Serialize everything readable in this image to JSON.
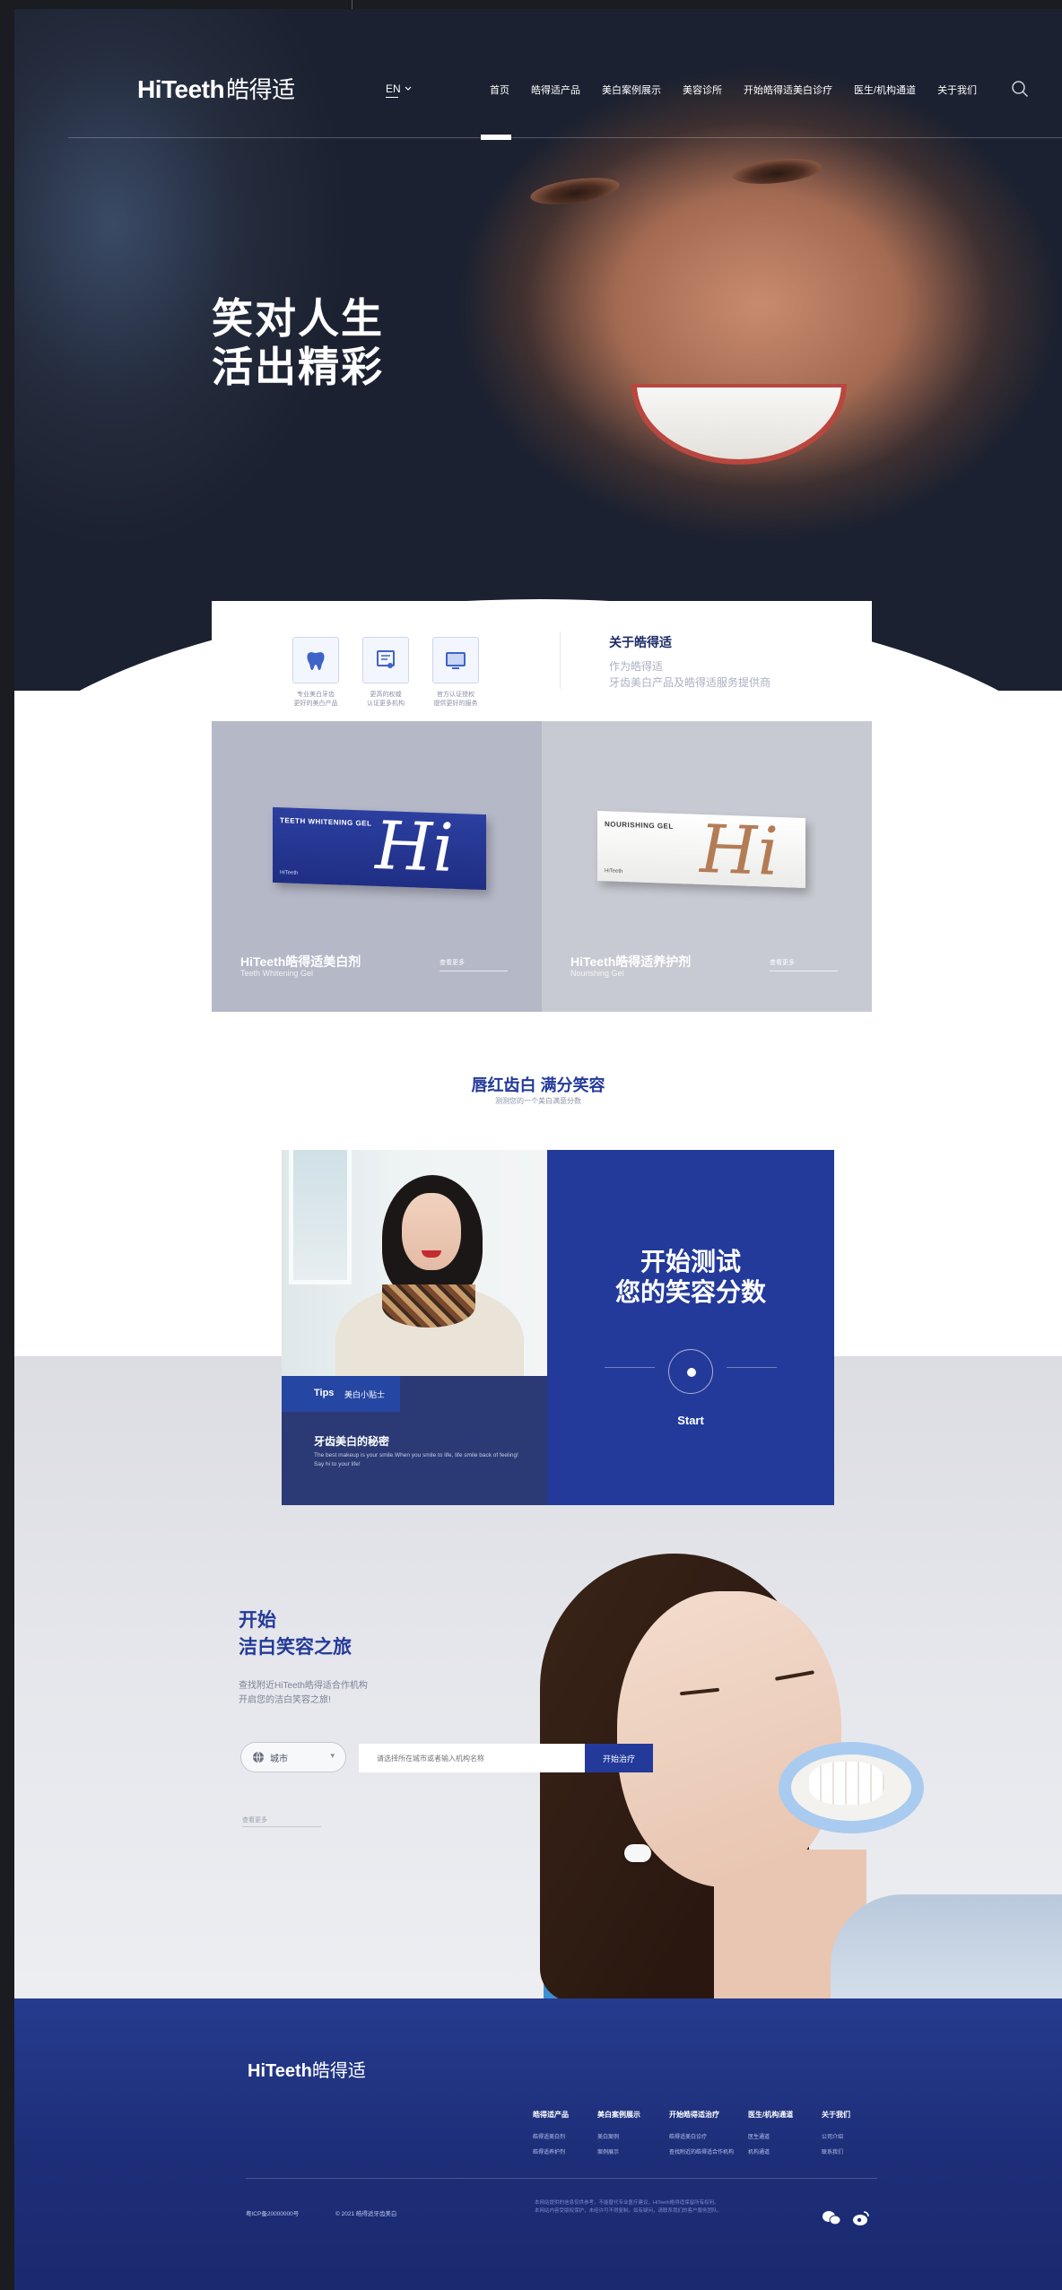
{
  "nav": {
    "brand": "HiTeeth",
    "brand_cn": "皓得适",
    "lang": "EN",
    "items": [
      "首页",
      "皓得适产品",
      "美白案例展示",
      "美容诊所",
      "开始皓得适美白诊疗",
      "医生/机构通道",
      "关于我们"
    ],
    "active_index": 0
  },
  "hero": {
    "title_line1": "笑对人生",
    "title_line2": "活出精彩"
  },
  "info": {
    "icons": [
      {
        "name": "tooth-icon",
        "caption1": "专业美白牙齿",
        "caption2": "更好的美白产品"
      },
      {
        "name": "certificate-icon",
        "caption1": "更高的权威",
        "caption2": "认证更多机构"
      },
      {
        "name": "monitor-icon",
        "caption1": "官方认证授权",
        "caption2": "提供更好的服务"
      }
    ],
    "about_title": "关于皓得适",
    "about_line1": "作为皓得适",
    "about_line2": "牙齿美白产品及皓得适服务提供商"
  },
  "products": [
    {
      "box_tag": "TEETH WHITENING GEL",
      "box_script": "Hi",
      "box_brand": "HiTeeth",
      "name": "HiTeeth皓得适美白剂",
      "sub": "Teeth Whitening Gel",
      "more": "查看更多"
    },
    {
      "box_tag": "NOURISHING GEL",
      "box_script": "Hi",
      "box_brand": "HiTeeth",
      "name": "HiTeeth皓得适养护剂",
      "sub": "Nourishing Gel",
      "more": "查看更多"
    }
  ],
  "smile_section": {
    "title": "唇红齿白 满分笑容",
    "subtitle": "测测您的一个美白满意分数",
    "tips_tab": "Tips",
    "tips_tab2": "美白小贴士",
    "tips_title": "牙齿美白的秘密",
    "tips_body": "The best makeup is your smile.When you smile to life, life smile back of feeling! Say hi to your life!",
    "quiz_line1": "开始测试",
    "quiz_line2": "您的笑容分数",
    "quiz_start": "Start"
  },
  "journey": {
    "title_line1": "开始",
    "title_line2": "洁白笑容之旅",
    "desc_line1": "查找附近HiTeeth皓得适合作机构",
    "desc_line2": "开启您的洁白笑容之旅!",
    "region_value": "城市",
    "search_placeholder": "请选择所在城市或者输入机构名称",
    "search_button": "开始治疗",
    "note": "查看更多"
  },
  "footer": {
    "brand": "HiTeeth",
    "brand_cn": "皓得适",
    "columns": [
      {
        "head": "皓得适产品",
        "items": [
          "皓得适美白剂",
          "皓得适养护剂"
        ]
      },
      {
        "head": "美白案例展示",
        "items": [
          "美白案例",
          "案例展示"
        ]
      },
      {
        "head": "开始皓得适治疗",
        "items": [
          "皓得适美白诊疗",
          "查找附近的皓得适合作机构"
        ]
      },
      {
        "head": "医生/机构通道",
        "items": [
          "医生通道",
          "机构通道"
        ]
      },
      {
        "head": "关于我们",
        "items": [
          "公司介绍",
          "联系我们"
        ]
      }
    ],
    "copyright": "粤ICP备20000000号",
    "address": "© 2021 皓得适牙齿美白",
    "legal": "本网站提供的信息仅供参考，不能替代专业医疗建议，HiTeeth皓得适保留所有权利。本网站内容受版权保护，未经许可不得复制。如有疑问，请联系我们的客户服务团队。"
  },
  "colors": {
    "brand_blue": "#233a9a",
    "footer_blue": "#1d2e78",
    "accent_text": "#233a99"
  }
}
